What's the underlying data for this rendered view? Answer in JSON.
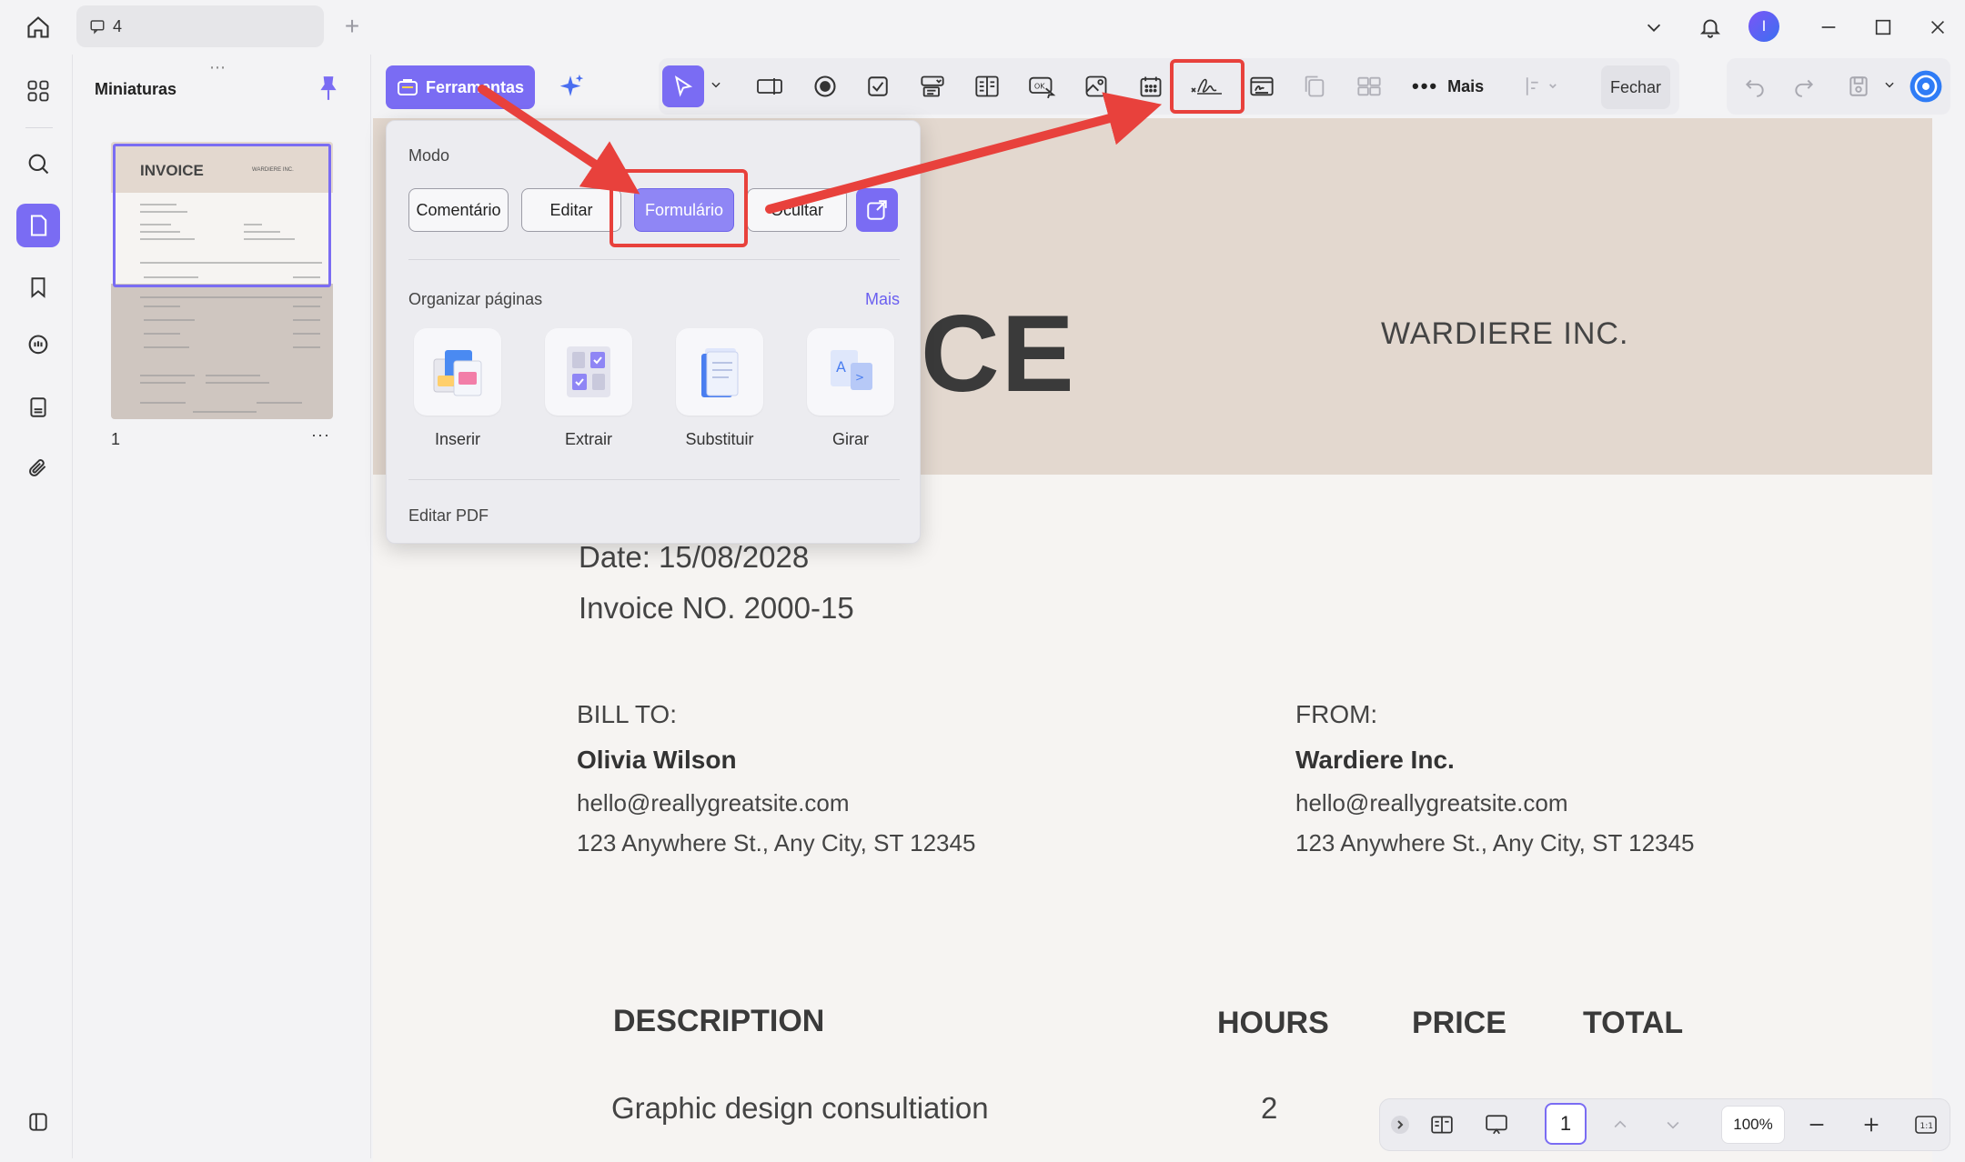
{
  "titlebar": {
    "tab_count": "4",
    "avatar_initial": "I"
  },
  "sidebar": {
    "panel_title": "Miniaturas",
    "page_number": "1",
    "thumbnail": {
      "title": "INVOICE",
      "company": "WARDIERE INC."
    }
  },
  "toolbar": {
    "tools_label": "Ferramentas",
    "more_label": "Mais",
    "close_label": "Fechar"
  },
  "popup": {
    "mode_heading": "Modo",
    "modes": [
      "Comentário",
      "Editar",
      "Formulário",
      "Ocultar"
    ],
    "active_mode": "Formulário",
    "organize_heading": "Organizar páginas",
    "organize_more": "Mais",
    "organize_items": [
      "Inserir",
      "Extrair",
      "Substituir",
      "Girar"
    ],
    "edit_heading": "Editar PDF"
  },
  "document": {
    "title_fragment": "CE",
    "company": "WARDIERE INC.",
    "date": "Date: 15/08/2028",
    "invoice_no": "Invoice NO. 2000-15",
    "bill_to": {
      "heading": "BILL TO:",
      "name": "Olivia  Wilson",
      "email": "hello@reallygreatsite.com",
      "address": "123 Anywhere St., Any City, ST 12345"
    },
    "from": {
      "heading": "FROM:",
      "name": "Wardiere Inc.",
      "email": "hello@reallygreatsite.com",
      "address": "123 Anywhere St., Any City, ST 12345"
    },
    "table": {
      "headers": [
        "DESCRIPTION",
        "HOURS",
        "PRICE",
        "TOTAL"
      ],
      "rows": [
        {
          "description": "Graphic design consultiation",
          "hours": "2"
        }
      ]
    }
  },
  "status_bar": {
    "page": "1",
    "zoom": "100%"
  },
  "colors": {
    "accent": "#7a6cf3",
    "annotation_red": "#e8413c",
    "doc_header": "#e3d8cf"
  }
}
